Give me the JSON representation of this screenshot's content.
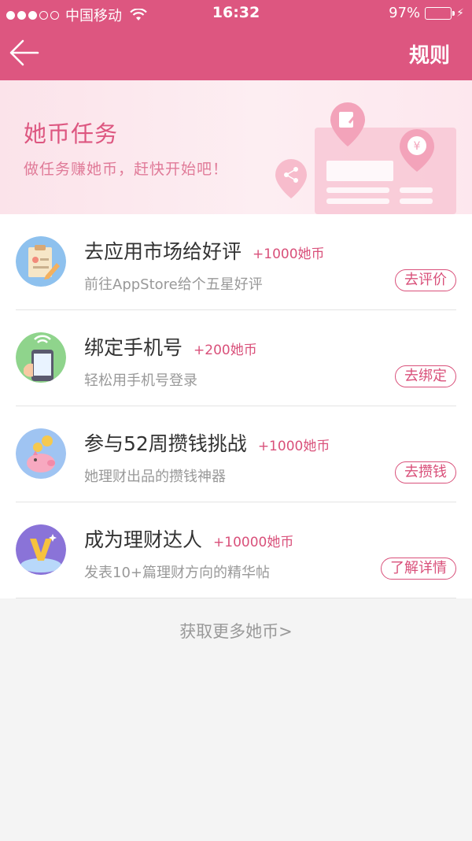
{
  "status_bar": {
    "carrier": "中国移动",
    "time": "16:32",
    "battery_percent": "97%",
    "battery_level": 0.97,
    "signal_icon": "signal-dots-icon",
    "wifi_icon": "wifi-icon"
  },
  "nav": {
    "back_icon": "arrow-left-icon",
    "rules_label": "规则"
  },
  "banner": {
    "title": "她币任务",
    "subtitle": "做任务赚她币，赶快开始吧！"
  },
  "tasks": [
    {
      "icon": "clipboard-review-icon",
      "title": "去应用市场给好评",
      "reward": "+1000她币",
      "desc": "前往AppStore给个五星好评",
      "action": "去评价"
    },
    {
      "icon": "phone-bind-icon",
      "title": "绑定手机号",
      "reward": "+200她币",
      "desc": "轻松用手机号登录",
      "action": "去绑定"
    },
    {
      "icon": "piggy-bank-icon",
      "title": "参与52周攒钱挑战",
      "reward": "+1000她币",
      "desc": "她理财出品的攒钱神器",
      "action": "去攒钱"
    },
    {
      "icon": "v-badge-icon",
      "title": "成为理财达人",
      "reward": "+10000她币",
      "desc": "发表10+篇理财方向的精华帖",
      "action": "了解详情"
    }
  ],
  "footer": {
    "more_label": "获取更多她币>"
  },
  "colors": {
    "brand": "#dd5680",
    "accent_text": "#d9507a",
    "page_bg": "#f4f4f4"
  }
}
